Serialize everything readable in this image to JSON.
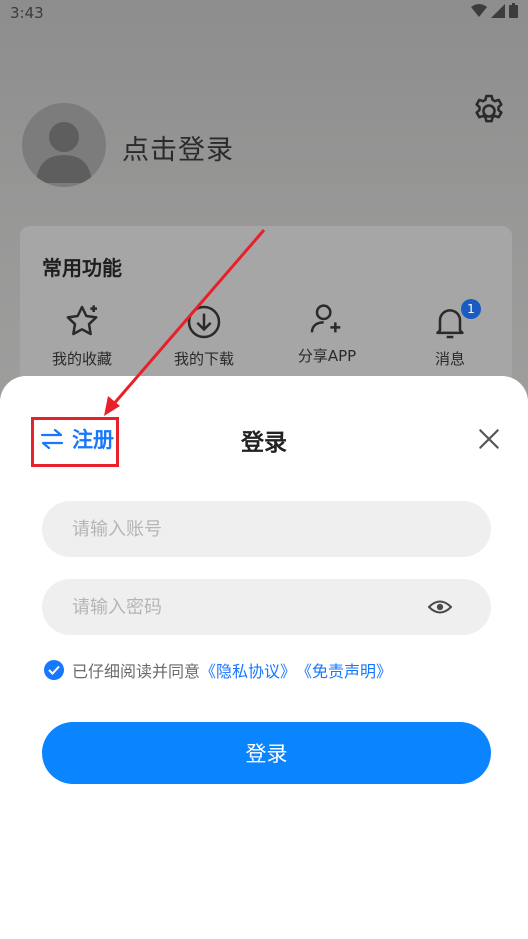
{
  "status_bar": {
    "time": "3:43"
  },
  "profile": {
    "login_prompt": "点击登录"
  },
  "functions": {
    "title": "常用功能",
    "items": [
      {
        "label": "我的收藏",
        "icon": "star-icon"
      },
      {
        "label": "我的下载",
        "icon": "download-icon"
      },
      {
        "label": "分享APP",
        "icon": "add-user-icon"
      },
      {
        "label": "消息",
        "icon": "bell-icon",
        "badge": "1"
      }
    ]
  },
  "login_sheet": {
    "register_label": "注册",
    "title": "登录",
    "account_placeholder": "请输入账号",
    "password_placeholder": "请输入密码",
    "agreement_text": "已仔细阅读并同意",
    "privacy_link": "《隐私协议》",
    "disclaimer_link": "《免责声明》",
    "login_button": "登录"
  },
  "colors": {
    "accent": "#1677ff",
    "button": "#0a84ff",
    "annotation": "#e8202a"
  }
}
